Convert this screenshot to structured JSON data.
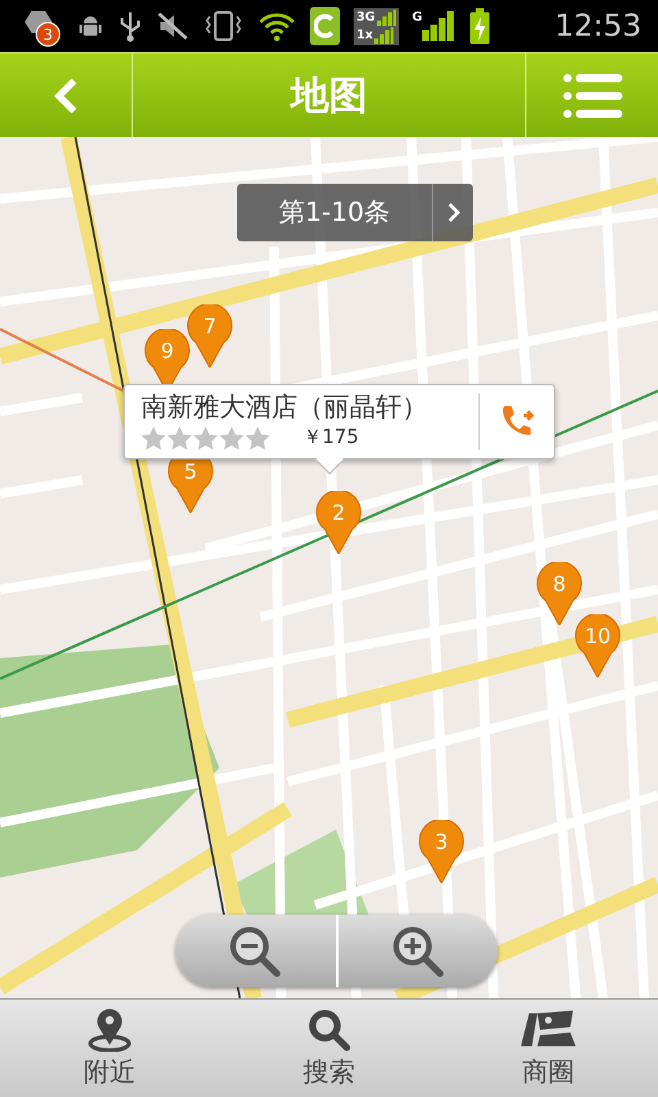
{
  "status_bar": {
    "notification_count": "3",
    "network_labels": [
      "3G",
      "1x",
      "G"
    ],
    "time": "12:53"
  },
  "header": {
    "title": "地图"
  },
  "map": {
    "pager": {
      "label": "第1-10条"
    },
    "pins": [
      {
        "number": "7"
      },
      {
        "number": "9"
      },
      {
        "number": "5"
      },
      {
        "number": "2"
      },
      {
        "number": "8"
      },
      {
        "number": "10"
      },
      {
        "number": "3"
      }
    ],
    "popup": {
      "name": "南新雅大酒店（丽晶轩）",
      "stars": 0,
      "price": "￥175"
    }
  },
  "bottom_nav": [
    {
      "label": "附近",
      "kind": "nearby"
    },
    {
      "label": "搜索",
      "kind": "search"
    },
    {
      "label": "商圈",
      "kind": "district"
    }
  ]
}
